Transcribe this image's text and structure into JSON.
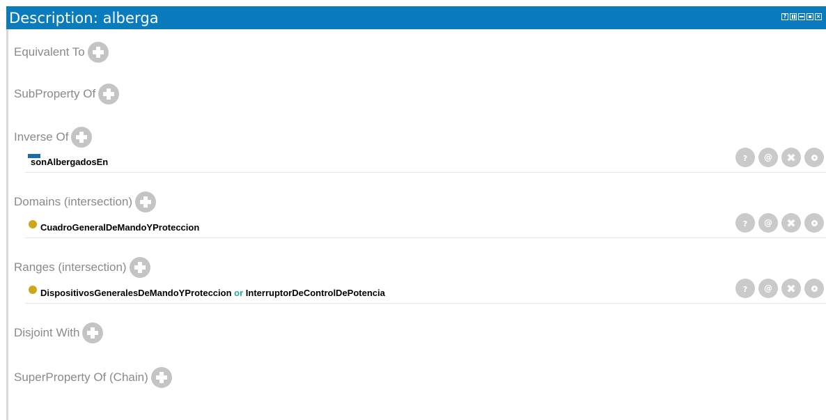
{
  "window": {
    "title": "Description: alberga",
    "controls": [
      "help-icon",
      "split-icon",
      "minimize-icon",
      "maximize-icon",
      "close-icon"
    ]
  },
  "sections": {
    "equivalent_to": "Equivalent To",
    "subproperty_of": "SubProperty Of",
    "inverse_of": "Inverse Of",
    "domains": "Domains (intersection)",
    "ranges": "Ranges (intersection)",
    "disjoint_with": "Disjoint With",
    "superproperty_chain": "SuperProperty Of (Chain)"
  },
  "inverse_items": [
    {
      "label": "sonAlbergadosEn",
      "icon": "object-property-icon"
    }
  ],
  "domain_items": [
    {
      "label": "CuadroGeneralDeMandoYProteccion",
      "icon": "class-icon"
    }
  ],
  "range_items": [
    {
      "label_a": "DispositivosGeneralesDeMandoYProteccion",
      "connector": "or",
      "label_b": "InterruptorDeControlDePotencia",
      "icon": "class-icon"
    }
  ],
  "row_actions": {
    "explain": "?",
    "annotate": "@",
    "delete": "✖",
    "edit": ""
  },
  "colors": {
    "titlebar": "#0a7bbd",
    "section_text": "#8a8a8a",
    "plus_button": "#c4c4c4",
    "property_icon": "#1a6dab",
    "class_icon": "#d1a51a",
    "or_keyword": "#29a7a1"
  }
}
